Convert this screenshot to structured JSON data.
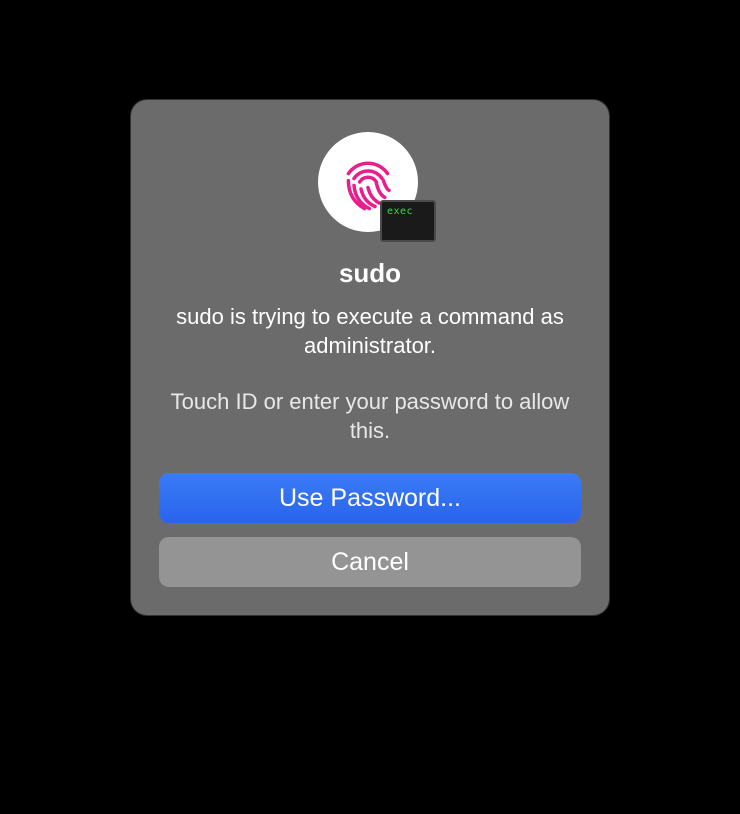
{
  "dialog": {
    "title": "sudo",
    "message": "sudo is trying to execute a command as administrator.",
    "instruction": "Touch ID or enter your password to allow this.",
    "terminal_badge_text": "exec",
    "buttons": {
      "primary": "Use Password...",
      "secondary": "Cancel"
    }
  }
}
